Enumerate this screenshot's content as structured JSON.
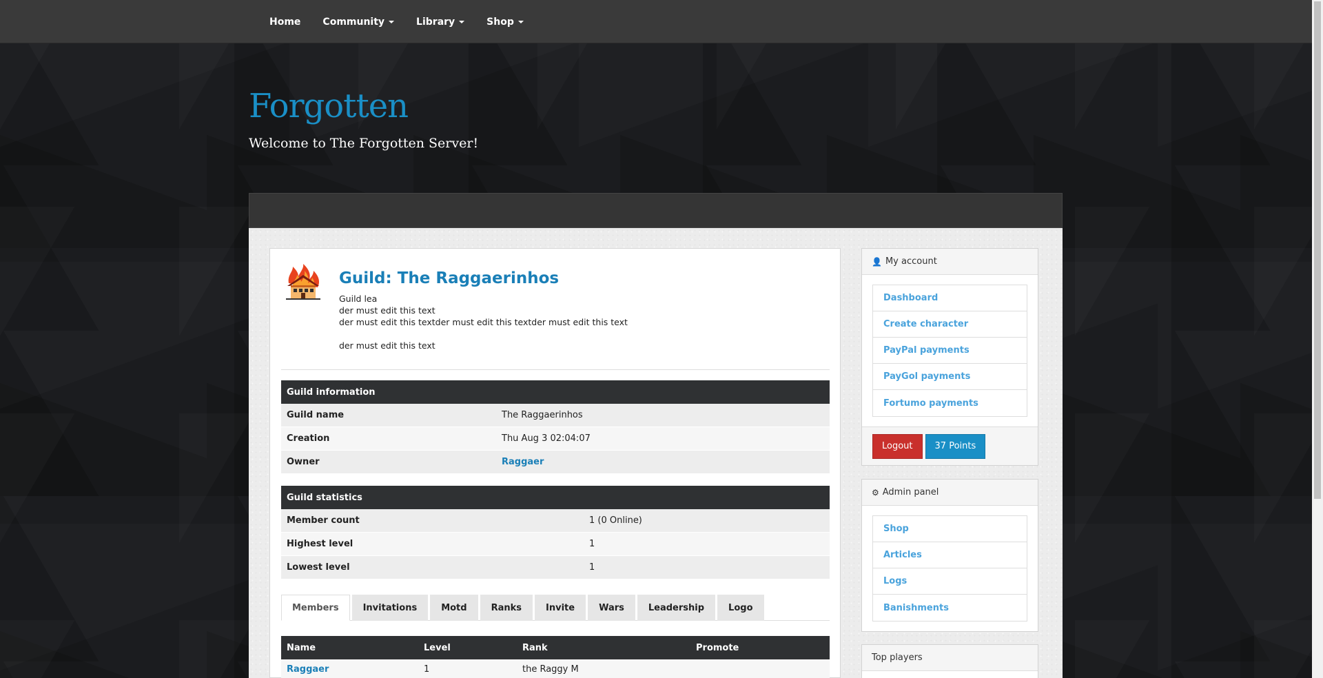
{
  "nav": {
    "items": [
      {
        "label": "Home",
        "dropdown": false
      },
      {
        "label": "Community",
        "dropdown": true
      },
      {
        "label": "Library",
        "dropdown": true
      },
      {
        "label": "Shop",
        "dropdown": true
      }
    ]
  },
  "header": {
    "title": "Forgotten",
    "subtitle": "Welcome to The Forgotten Server!"
  },
  "guild": {
    "heading": "Guild: The Raggaerinhos",
    "description": [
      "Guild lea",
      "der must edit this text",
      "der must edit this textder must edit this textder must edit this text",
      "",
      "der must edit this text"
    ],
    "info_title": "Guild information",
    "info": [
      {
        "label": "Guild name",
        "value": "The Raggaerinhos"
      },
      {
        "label": "Creation",
        "value": "Thu Aug 3 02:04:07"
      },
      {
        "label": "Owner",
        "value": "Raggaer"
      }
    ],
    "stats_title": "Guild statistics",
    "stats": [
      {
        "label": "Member count",
        "value": "1 (0 Online)"
      },
      {
        "label": "Highest level",
        "value": "1"
      },
      {
        "label": "Lowest level",
        "value": "1"
      }
    ],
    "tabs": [
      "Members",
      "Invitations",
      "Motd",
      "Ranks",
      "Invite",
      "Wars",
      "Leadership",
      "Logo"
    ],
    "members_columns": [
      "Name",
      "Level",
      "Rank",
      "Promote"
    ],
    "members": [
      {
        "name": "Raggaer",
        "level": "1",
        "rank": "the Raggy M",
        "promote": ""
      }
    ]
  },
  "account": {
    "title": "My account",
    "items": [
      "Dashboard",
      "Create character",
      "PayPal payments",
      "PayGol payments",
      "Fortumo payments"
    ],
    "logout_label": "Logout",
    "points_label": "37 Points"
  },
  "admin": {
    "title": "Admin panel",
    "items": [
      "Shop",
      "Articles",
      "Logs",
      "Banishments"
    ]
  },
  "top_players": {
    "title": "Top players"
  },
  "colors": {
    "accent": "#1a8fc6",
    "link": "#4aa3dc",
    "danger": "#c9302c",
    "navbar": "#3a3a3a"
  }
}
